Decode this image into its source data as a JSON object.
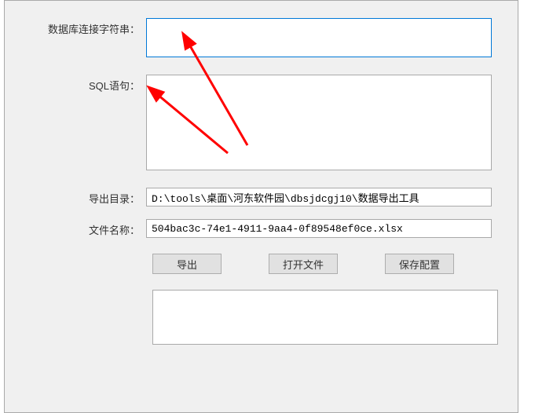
{
  "labels": {
    "connection_string": "数据库连接字符串：",
    "sql_statement": "SQL语句：",
    "output_dir": "导出目录：",
    "file_name": "文件名称："
  },
  "fields": {
    "connection_string": "",
    "sql_statement": "",
    "output_dir": "D:\\tools\\桌面\\河东软件园\\dbsjdcgj10\\数据导出工具",
    "file_name": "504bac3c-74e1-4911-9aa4-0f89548ef0ce.xlsx",
    "log": ""
  },
  "buttons": {
    "export": "导出",
    "open_file": "打开文件",
    "save_config": "保存配置"
  }
}
